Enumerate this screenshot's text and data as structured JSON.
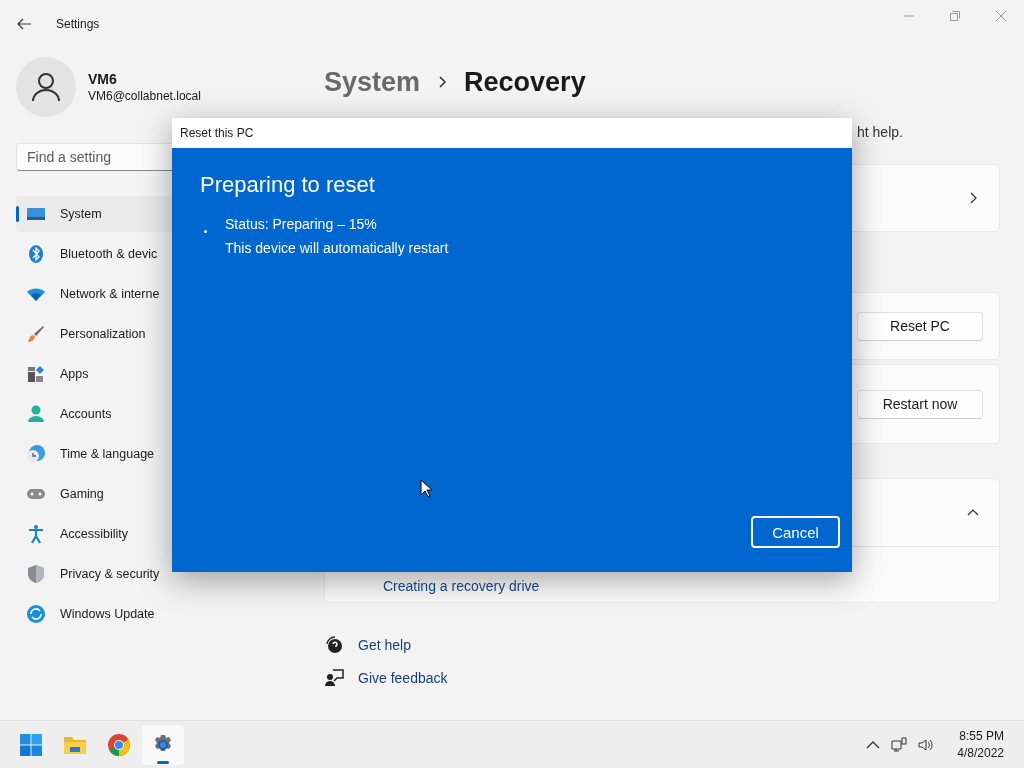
{
  "window": {
    "title": "Settings"
  },
  "user": {
    "name": "VM6",
    "email": "VM6@collabnet.local"
  },
  "search": {
    "placeholder": "Find a setting"
  },
  "nav": [
    {
      "label": "System",
      "kind": "system",
      "selected": true
    },
    {
      "label": "Bluetooth & devic",
      "kind": "bluetooth",
      "selected": false
    },
    {
      "label": "Network & interne",
      "kind": "network",
      "selected": false
    },
    {
      "label": "Personalization",
      "kind": "brush",
      "selected": false
    },
    {
      "label": "Apps",
      "kind": "apps",
      "selected": false
    },
    {
      "label": "Accounts",
      "kind": "accounts",
      "selected": false
    },
    {
      "label": "Time & language",
      "kind": "time",
      "selected": false
    },
    {
      "label": "Gaming",
      "kind": "gaming",
      "selected": false
    },
    {
      "label": "Accessibility",
      "kind": "accessibility",
      "selected": false
    },
    {
      "label": "Privacy & security",
      "kind": "shield",
      "selected": false
    },
    {
      "label": "Windows Update",
      "kind": "update",
      "selected": false
    }
  ],
  "breadcrumb": {
    "parent": "System",
    "current": "Recovery"
  },
  "description": "ht help.",
  "cards": [
    {
      "kind": "link"
    },
    {
      "kind": "button",
      "button": "Reset PC"
    },
    {
      "kind": "button",
      "button": "Restart now"
    },
    {
      "kind": "expander",
      "expanded": true,
      "children": [
        "Creating a recovery drive"
      ]
    }
  ],
  "links": [
    {
      "label": "Get help",
      "kind": "help"
    },
    {
      "label": "Give feedback",
      "kind": "feedback"
    }
  ],
  "dialog": {
    "title": "Reset this PC",
    "heading": "Preparing to reset",
    "lines": [
      "Status: Preparing – 15%",
      "This device will automatically restart"
    ],
    "button": "Cancel"
  },
  "taskbar": {
    "apps": [
      {
        "kind": "start",
        "selected": false
      },
      {
        "kind": "folder",
        "selected": false
      },
      {
        "kind": "browser",
        "selected": false
      },
      {
        "kind": "settings",
        "selected": true
      }
    ],
    "time": "8:55 PM",
    "date": "4/8/2022"
  }
}
